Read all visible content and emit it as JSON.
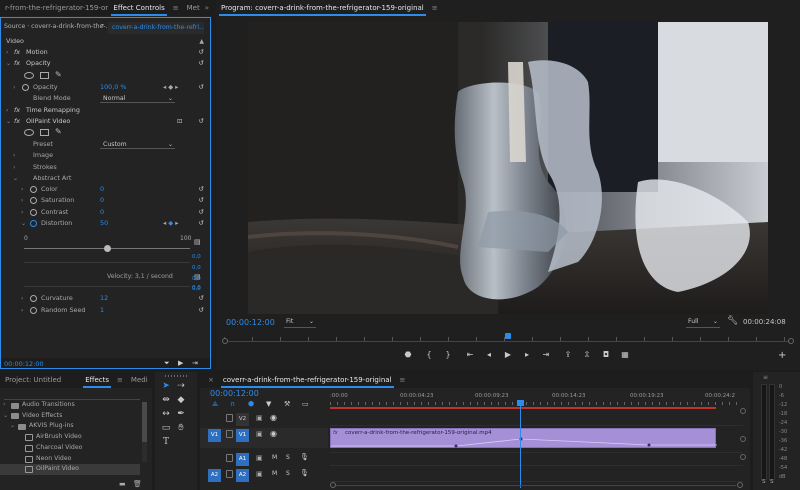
{
  "effect_controls": {
    "tabs": [
      "r-from-the-refrigerator-159-original.mp4",
      "Effect Controls",
      "Met"
    ],
    "source_label": "Source · coverr-a-drink-from-the-...",
    "clip_label": "coverr-a-drink-from-the-refri...",
    "section_video": "Video",
    "motion": "Motion",
    "opacity": "Opacity",
    "opacity_label": "Opacity",
    "opacity_value": "100,0 %",
    "blend_mode_label": "Blend Mode",
    "blend_mode_value": "Normal",
    "time_remapping": "Time Remapping",
    "oilpaint": "OilPaint Video",
    "preset_label": "Preset",
    "preset_value": "Custom",
    "image": "Image",
    "strokes": "Strokes",
    "abstract_art": "Abstract Art",
    "color_label": "Color",
    "color_value": "0",
    "saturation_label": "Saturation",
    "saturation_value": "0",
    "contrast_label": "Contrast",
    "contrast_value": "0",
    "distortion_label": "Distortion",
    "distortion_value": "50",
    "slider_min": "0",
    "slider_max": "100",
    "graph_values": [
      "0,0",
      "0,0",
      "0,0",
      "0,0",
      "0,0"
    ],
    "velocity": "Velocity: 3,1 / second",
    "curvature_label": "Curvature",
    "curvature_value": "12",
    "random_seed_label": "Random Seed",
    "random_seed_value": "1",
    "timecode": "00:00:12:00",
    "distortion_slider_fraction": 0.5
  },
  "program": {
    "title": "Program: coverr-a-drink-from-the-refrigerator-159-original",
    "timecode": "00:00:12:00",
    "fit": "Fit",
    "quality": "Full",
    "duration": "00:00:24:08",
    "playhead_fraction": 0.5
  },
  "project": {
    "tabs": [
      "Project: Untitled",
      "Effects",
      "Medi"
    ],
    "items": [
      {
        "label": "Audio Transitions",
        "indent": 1,
        "kind": "folder"
      },
      {
        "label": "Video Effects",
        "indent": 1,
        "kind": "folder"
      },
      {
        "label": "AKVIS Plug-ins",
        "indent": 2,
        "kind": "folder"
      },
      {
        "label": "AirBrush Video",
        "indent": 3,
        "kind": "fx"
      },
      {
        "label": "Charcoal Video",
        "indent": 3,
        "kind": "fx"
      },
      {
        "label": "Neon Video",
        "indent": 3,
        "kind": "fx"
      },
      {
        "label": "OilPaint Video",
        "indent": 3,
        "kind": "fx"
      }
    ]
  },
  "timeline": {
    "title": "coverr-a-drink-from-the-refrigerator-159-original",
    "timecode": "00:00:12:00",
    "ruler": [
      ":00:00",
      "00:00:04:23",
      "00:00:09:23",
      "00:00:14:23",
      "00:00:19:23",
      "00:00:24:2"
    ],
    "clip_label": "coverr-a-drink-from-the-refrigerator-159-original.mp4",
    "tracks": [
      {
        "src": "",
        "name": "V2"
      },
      {
        "src": "V1",
        "name": "V1"
      },
      {
        "src": "",
        "name": "A1"
      },
      {
        "src": "A2",
        "name": "A2"
      }
    ],
    "solo_m": "M",
    "solo_s": "S"
  },
  "meter": {
    "labels": [
      "0",
      "-6",
      "-12",
      "-18",
      "-24",
      "-30",
      "-36",
      "-42",
      "-48",
      "-54",
      "dB"
    ],
    "bottom": [
      "S",
      "S"
    ]
  },
  "colors": {
    "accent": "#2d8ceb",
    "clip": "#a58fd6",
    "panel": "#232323"
  }
}
